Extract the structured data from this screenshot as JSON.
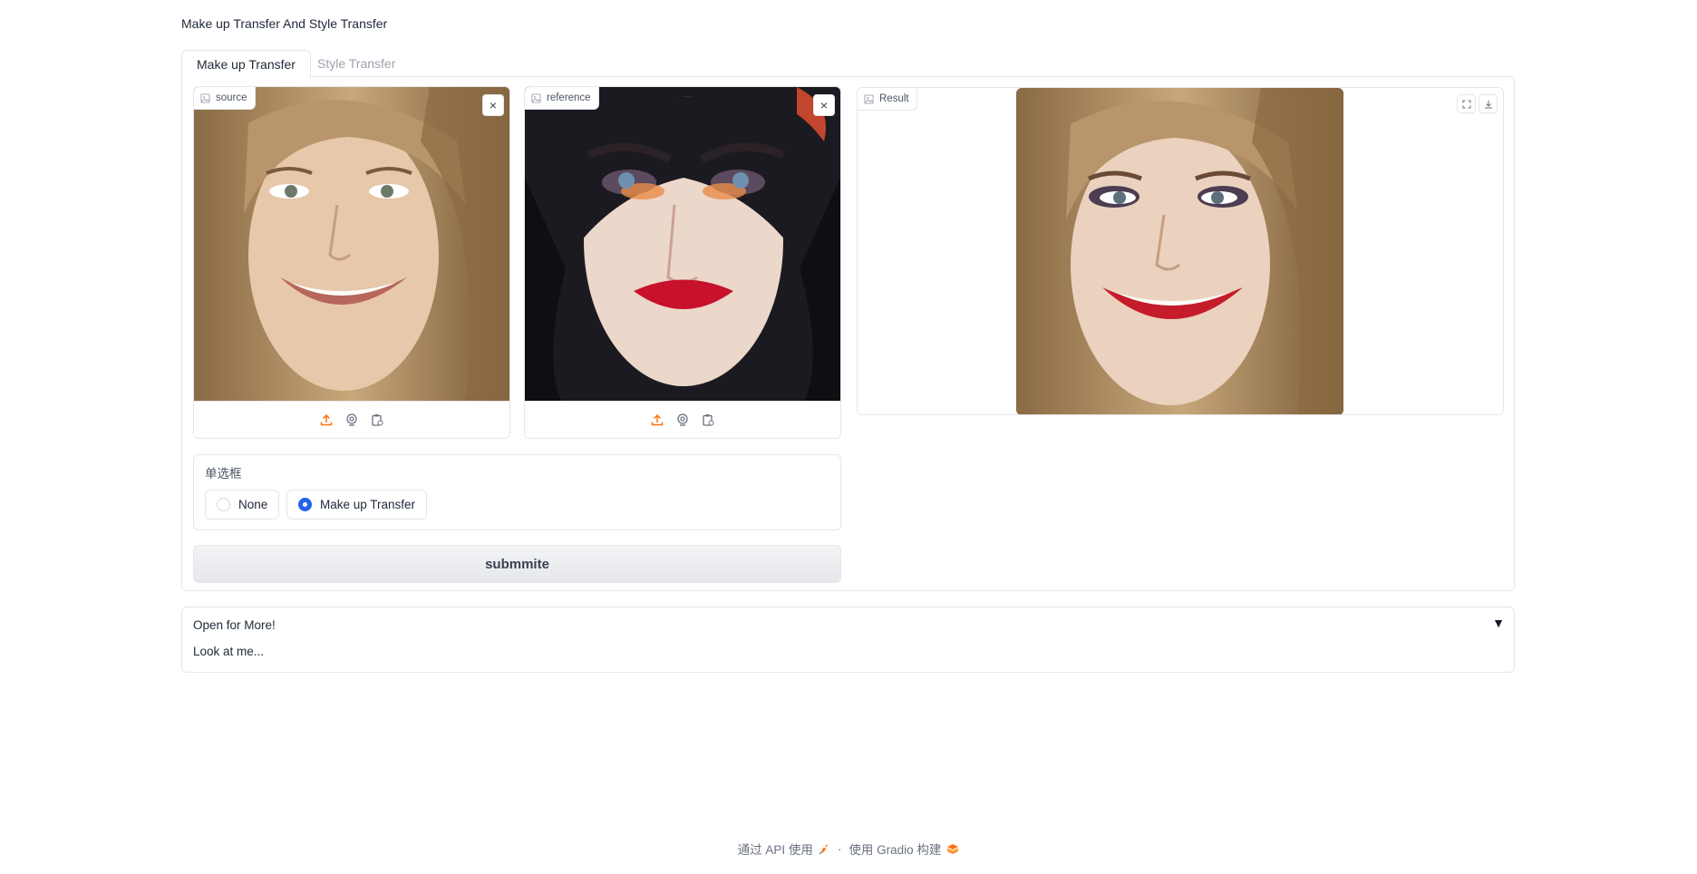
{
  "app": {
    "title": "Make up Transfer And Style Transfer"
  },
  "tabs": [
    {
      "label": "Make up Transfer",
      "active": true
    },
    {
      "label": "Style Transfer",
      "active": false
    }
  ],
  "inputs": {
    "source": {
      "label": "source",
      "close_symbol": "×"
    },
    "reference": {
      "label": "reference",
      "close_symbol": "×"
    }
  },
  "output": {
    "label": "Result"
  },
  "radio": {
    "label": "单选框",
    "options": [
      {
        "label": "None",
        "checked": false
      },
      {
        "label": "Make up Transfer",
        "checked": true
      }
    ]
  },
  "submit": {
    "label": "submmite"
  },
  "accordion": {
    "title": "Open for More!",
    "arrow": "▼",
    "content": "Look at me..."
  },
  "footer": {
    "api_text": "通过 API 使用",
    "separator": "·",
    "built_text": "使用 Gradio 构建"
  },
  "colors": {
    "accent": "#f97316",
    "radio_checked": "#2563eb",
    "border": "#e5e7eb"
  },
  "icons": [
    "image-icon",
    "close-icon",
    "upload-icon",
    "webcam-icon",
    "clipboard-icon",
    "fullscreen-icon",
    "download-icon",
    "rocket-icon",
    "gradio-logo-icon"
  ]
}
